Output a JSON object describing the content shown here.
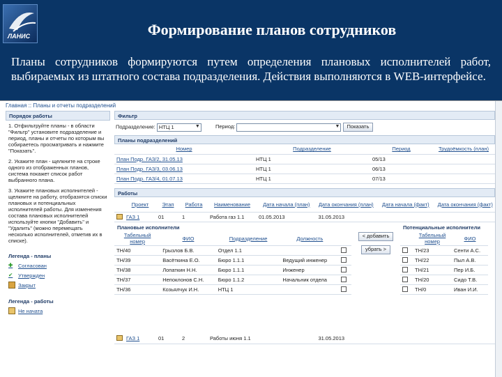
{
  "slide": {
    "title": "Формирование планов сотрудников",
    "logo": "ЛАНИС",
    "intro": "Планы сотрудников формируются путем определения плановых исполнителей работ, выбираемых из штатного состава подразделения. Действия выполняются в WEB-интерфейсе."
  },
  "app": {
    "breadcrumb": "Главная :: Планы и отчеты подразделений",
    "left": {
      "order_title": "Порядок работы",
      "steps": [
        "1. Отфильтруйте планы - в области \"Фильтр\" установите подразделение и период, планы и отчеты по которым вы собираетесь просматривать и нажмите \"Показать\".",
        "2. Укажите план - щелкните на строке одного из отображенных планов, система покажет список работ выбранного плана.",
        "3. Укажите плановых исполнителей - щелкните на работу, отобразятся списки плановых и потенциальных исполнителей работы. Для изменения состава плановых исполнителей используйте кнопки \"Добавить\" и \"Удалить\" (можно перемещать несколько исполнителей, отметив их в списке)."
      ],
      "legend_plans_title": "Легенда - планы",
      "legend_plans": [
        "Согласован",
        "Утвержден",
        "Закрыт"
      ],
      "legend_works_title": "Легенда - работы",
      "legend_works": [
        "Не начата"
      ]
    },
    "filter": {
      "title": "Фильтр",
      "dept_label": "Подразделение:",
      "dept_value": "НТЦ 1",
      "period_label": "Период:",
      "period_value": "",
      "show_button": "Показать"
    },
    "plans": {
      "title": "Планы подразделений",
      "headers": [
        "Номер",
        "Подразделение",
        "Период",
        "Трудоёмкость (план)"
      ],
      "rows": [
        [
          "План Подр. ГАЗ/2, 31.05.13",
          "НТЦ 1",
          "05/13",
          ""
        ],
        [
          "План Подр. ГАЗ/3, 03.06.13",
          "НТЦ 1",
          "06/13",
          ""
        ],
        [
          "План Подр. ГАЗ/4, 01.07.13",
          "НТЦ 1",
          "07/13",
          ""
        ]
      ]
    },
    "works": {
      "title": "Работы",
      "headers": [
        "Проект",
        "Этап",
        "Работа",
        "Наименование",
        "Дата начала (план)",
        "Дата окончания (план)",
        "Дата начала (факт)",
        "Дата окончания (факт)"
      ],
      "rows": [
        [
          "ГАЗ 1",
          "01",
          "1",
          "Работа газ 1.1",
          "01.05.2013",
          "31.05.2013",
          "",
          ""
        ],
        [
          "ГАЗ 1",
          "01",
          "2",
          "Работы июня 1.1",
          "",
          "31.05.2013",
          "",
          ""
        ]
      ]
    },
    "planned": {
      "title": "Плановые исполнители",
      "headers": [
        "Табельный номер",
        "ФИО",
        "Подразделение",
        "Должность"
      ],
      "rows": [
        [
          "ТН/40",
          "Грызлов Б.В.",
          "Отдел 1.1",
          ""
        ],
        [
          "ТН/39",
          "Васёткина Е.О.",
          "Бюро 1.1.1",
          "Ведущий инженер"
        ],
        [
          "ТН/38",
          "Лопаткин Н.Н.",
          "Бюро 1.1.1",
          "Инженер"
        ],
        [
          "ТН/37",
          "Непоклонов С.Н.",
          "Бюро 1.1.2",
          "Начальник отдела"
        ],
        [
          "ТН/36",
          "Козьялчук И.Н.",
          "НТЦ 1",
          ""
        ]
      ]
    },
    "add_button": "< добавить",
    "remove_button": "убрать >",
    "potential": {
      "title": "Потенциальные исполнители",
      "headers": [
        "Табельный номер",
        "ФИО"
      ],
      "rows": [
        [
          "ТН/23",
          "Сенти А.С."
        ],
        [
          "ТН/22",
          "Пыл А.В."
        ],
        [
          "ТН/21",
          "Пер И.Б."
        ],
        [
          "ТН/20",
          "Сидо Т.В."
        ],
        [
          "ТН/0",
          "Иван И.И."
        ]
      ]
    }
  }
}
